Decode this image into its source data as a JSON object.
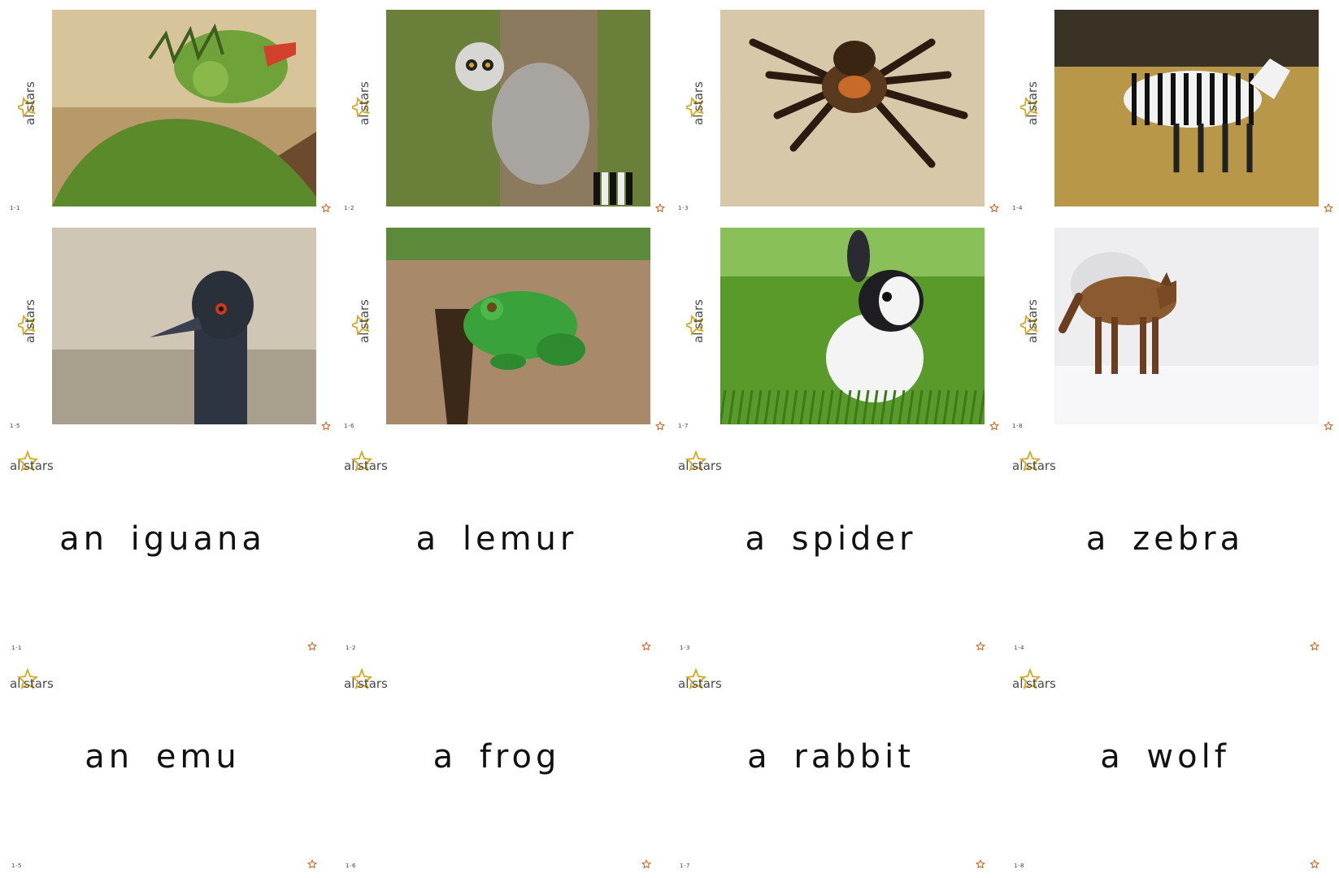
{
  "brand": {
    "part1": "al",
    "part2": "stars"
  },
  "star_color": "#d06a2a",
  "picture_cards": [
    {
      "code": "1-1",
      "animal": "iguana"
    },
    {
      "code": "1-2",
      "animal": "lemur"
    },
    {
      "code": "1-3",
      "animal": "spider"
    },
    {
      "code": "1-4",
      "animal": "zebra"
    },
    {
      "code": "1-5",
      "animal": "emu"
    },
    {
      "code": "1-6",
      "animal": "frog"
    },
    {
      "code": "1-7",
      "animal": "rabbit"
    },
    {
      "code": "1-8",
      "animal": "wolf"
    }
  ],
  "word_cards": [
    {
      "code": "1-1",
      "word": "an iguana"
    },
    {
      "code": "1-2",
      "word": "a lemur"
    },
    {
      "code": "1-3",
      "word": "a spider"
    },
    {
      "code": "1-4",
      "word": "a zebra"
    },
    {
      "code": "1-5",
      "word": "an emu"
    },
    {
      "code": "1-6",
      "word": "a frog"
    },
    {
      "code": "1-7",
      "word": "a rabbit"
    },
    {
      "code": "1-8",
      "word": "a wolf"
    }
  ]
}
